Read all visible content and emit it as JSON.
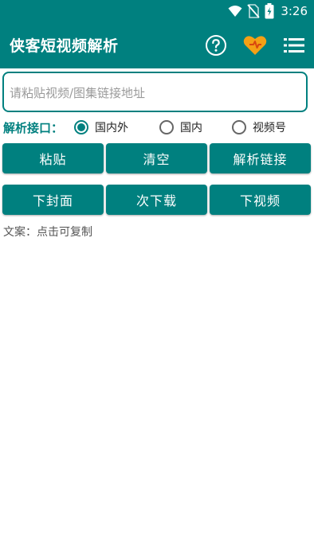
{
  "status_bar": {
    "time": "3:26",
    "icons": [
      "wifi-icon",
      "no-sim-icon",
      "battery-charging-icon"
    ]
  },
  "app_bar": {
    "title": "侠客短视频解析",
    "actions": [
      "help-icon",
      "heart-icon",
      "menu-list-icon"
    ]
  },
  "url_input": {
    "placeholder": "请粘贴视频/图集链接地址",
    "value": ""
  },
  "interface": {
    "label": "解析接口：",
    "options": [
      {
        "label": "国内外",
        "checked": true
      },
      {
        "label": "国内",
        "checked": false
      },
      {
        "label": "视频号",
        "checked": false
      }
    ]
  },
  "buttons_row1": {
    "paste": "粘贴",
    "clear": "清空",
    "parse": "解析链接"
  },
  "buttons_row2": {
    "cover": "下封面",
    "batch": "次下载",
    "video": "下视频"
  },
  "caption": "文案：点击可复制",
  "colors": {
    "primary": "#00807f",
    "heart": "#f4a015"
  }
}
